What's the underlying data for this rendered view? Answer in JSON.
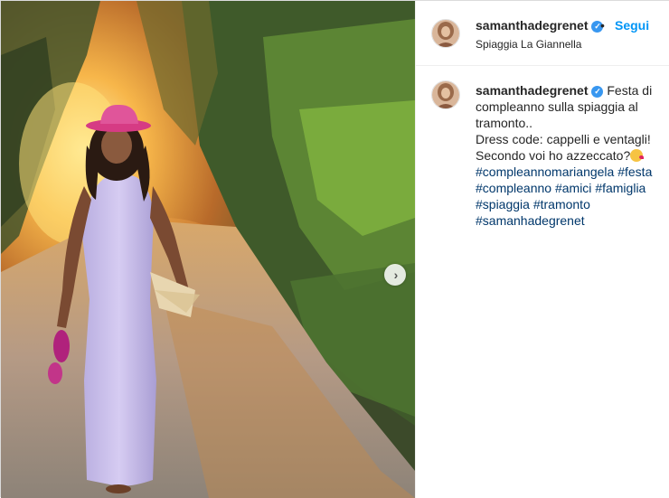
{
  "post": {
    "username": "samanthadegrenet",
    "follow_label": "Segui",
    "separator": "•",
    "location": "Spiaggia La Giannella"
  },
  "caption": {
    "username": "samanthadegrenet",
    "text_line1": "Festa di",
    "text_line2": "compleanno sulla spiaggia al",
    "text_line3": "tramonto..",
    "text_line4": "Dress code: cappelli e ventagli!",
    "text_line5": "Secondo voi ho azzeccato?",
    "emoji": "kiss-emoji",
    "hashtags": [
      "#compleannomariangela",
      "#festa",
      "#compleanno",
      "#amici",
      "#famiglia",
      "#spiaggia",
      "#tramonto",
      "#samanhadegrenet"
    ]
  },
  "icons": {
    "next": "chevron-right-icon",
    "verified": "verified-badge-icon"
  },
  "colors": {
    "link_blue": "#0095f6",
    "hashtag_blue": "#00376b",
    "verified_blue": "#3897f0",
    "text": "#262626"
  }
}
